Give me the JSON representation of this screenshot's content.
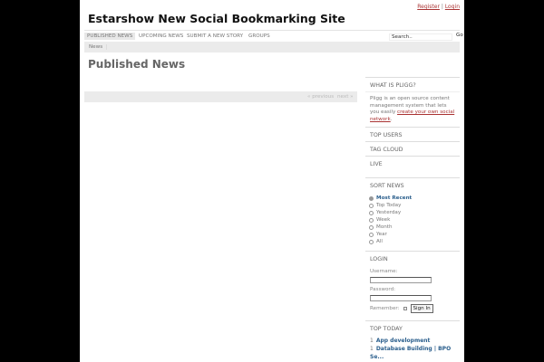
{
  "header": {
    "register": "Register",
    "separator": "|",
    "login": "Login",
    "site_title": "Estarshow New Social Bookmarking Site"
  },
  "nav": {
    "items": [
      "PUBLISHED NEWS",
      "UPCOMING NEWS",
      "SUBMIT A NEW STORY",
      "GROUPS"
    ],
    "search_value": "Search..",
    "go": "Go"
  },
  "breadcrumb": "News",
  "page_heading": "Published News",
  "pager": {
    "previous": "« previous",
    "next": "next »"
  },
  "sidebar": {
    "what_title": "WHAT IS PLIGG?",
    "what_text": "Pligg is an open source content management system that lets you easily ",
    "what_link": "create your own social network",
    "what_end": ".",
    "top_users": "TOP USERS",
    "tag_cloud": "TAG CLOUD",
    "live": "LIVE",
    "sort_title": "SORT NEWS",
    "sort_options": [
      "Most Recent",
      "Top Today",
      "Yesterday",
      "Week",
      "Month",
      "Year",
      "All"
    ],
    "login_title": "LOGIN",
    "username": "Username:",
    "password": "Password:",
    "remember": "Remember:",
    "sign_in": "Sign In",
    "top_today_title": "TOP TODAY",
    "top_today": [
      {
        "n": "1",
        "t": "App development"
      },
      {
        "n": "1",
        "t": "Database Building | BPO Se..."
      }
    ]
  }
}
